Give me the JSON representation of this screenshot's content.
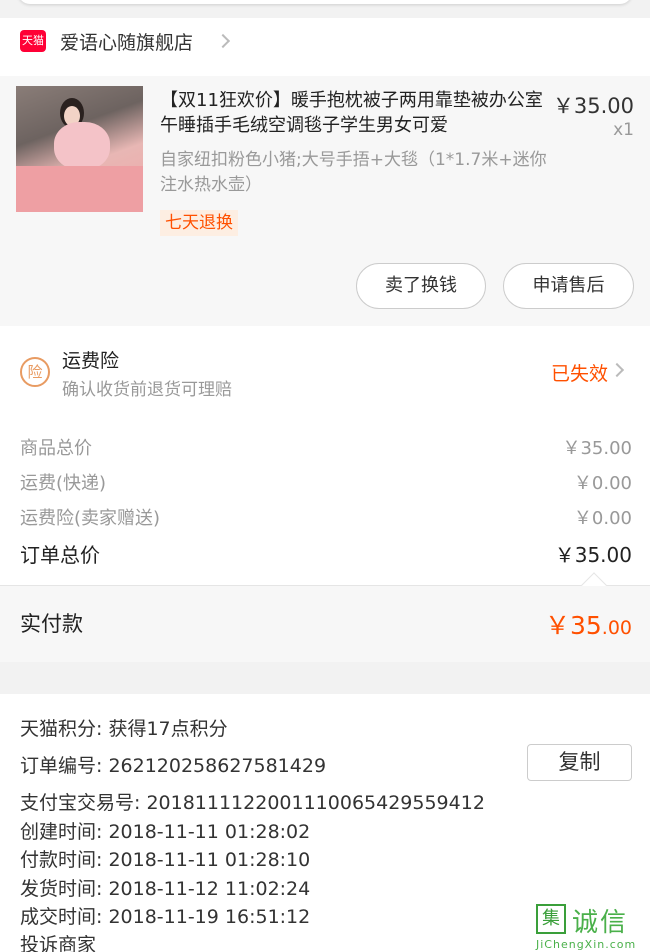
{
  "store": {
    "name": "爱语心随旗舰店",
    "logo_text": "天猫"
  },
  "product": {
    "title": "【双11狂欢价】暖手抱枕被子两用靠垫被办公室午睡插手毛绒空调毯子学生男女可爱",
    "price": "￥35.00",
    "quantity": "x1",
    "spec": "自家纽扣粉色小猪;大号手捂+大毯（1*1.7米+迷你注水热水壶）",
    "tag": "七天退换"
  },
  "actions": {
    "sell": "卖了换钱",
    "after_sale": "申请售后"
  },
  "insurance": {
    "icon_text": "险",
    "title": "运费险",
    "subtitle": "确认收货前退货可理赔",
    "status": "已失效"
  },
  "summary": {
    "rows": [
      {
        "label": "商品总价",
        "value": "￥35.00"
      },
      {
        "label": "运费(快递)",
        "value": "￥0.00"
      },
      {
        "label": "运费险(卖家赠送)",
        "value": "￥0.00"
      }
    ],
    "total": {
      "label": "订单总价",
      "value": "￥35.00"
    },
    "paid": {
      "label": "实付款",
      "value_main": "￥35",
      "value_cents": ".00"
    }
  },
  "order_info": {
    "points": "天猫积分:  获得17点积分",
    "order_no": "订单编号:  262120258627581429",
    "copy": "复制",
    "alipay": "支付宝交易号:  2018111122001110065429559412",
    "created": "创建时间:  2018-11-11 01:28:02",
    "paid": "付款时间:  2018-11-11 01:28:10",
    "shipped": "发货时间:  2018-11-12 11:02:24",
    "completed": "成交时间:  2018-11-19 16:51:12",
    "complaint": "投诉商家"
  },
  "watermark": {
    "box": "集",
    "text": "诚信",
    "url": "JiChengXin.com"
  },
  "colors": {
    "accent": "#ff5000",
    "tmall": "#ff0036"
  }
}
